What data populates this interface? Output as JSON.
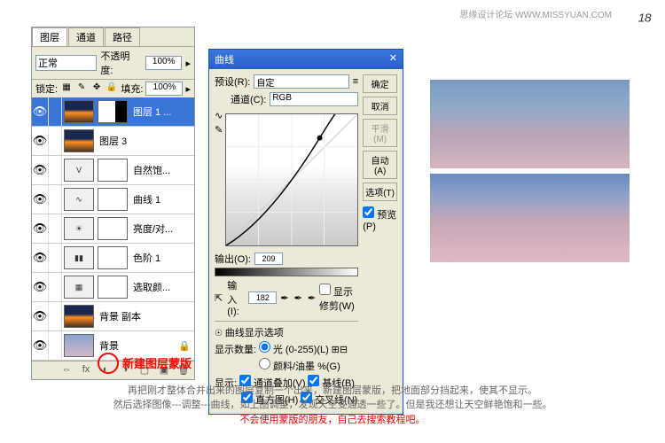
{
  "watermark": "思缘设计论坛  WWW.MISSYUAN.COM",
  "signature": "₁₈",
  "layers_panel": {
    "tabs": [
      "图层",
      "通道",
      "路径"
    ],
    "blend_mode": "正常",
    "opacity_label": "不透明度:",
    "opacity_value": "100%",
    "lock_label": "锁定:",
    "fill_label": "填充:",
    "fill_value": "100%",
    "layers": [
      {
        "name": "图层 1 ...",
        "selected": true,
        "hasMask": true,
        "thumb": "night"
      },
      {
        "name": "图层 3",
        "thumb": "night"
      },
      {
        "name": "自然饱...",
        "adj": "V",
        "hasMask": true
      },
      {
        "name": "曲线 1",
        "adj": "∿",
        "hasMask": true
      },
      {
        "name": "亮度/对...",
        "adj": "☀",
        "hasMask": true
      },
      {
        "name": "色阶 1",
        "adj": "▮▮",
        "hasMask": true
      },
      {
        "name": "选取颜...",
        "adj": "▦",
        "hasMask": true
      },
      {
        "name": "背景 副本",
        "thumb": "night"
      },
      {
        "name": "背景",
        "thumb": "sky",
        "locked": true
      }
    ]
  },
  "mask_annotation": "新建图层蒙版",
  "curves": {
    "title": "曲线",
    "preset_label": "预设(R):",
    "preset_value": "自定",
    "channel_label": "通道(C):",
    "channel_value": "RGB",
    "output_label": "输出(O):",
    "output_value": "209",
    "input_label": "输入(I):",
    "input_value": "182",
    "show_clipping": "显示修剪(W)",
    "display_options": "曲线显示选项",
    "display_amount": "显示数量:",
    "light_option": "光 (0-255)(L)",
    "pigment_option": "颜料/油墨 %(G)",
    "show_label": "显示:",
    "channel_overlay": "通道叠加(V)",
    "baseline": "基线(B)",
    "histogram_chk": "直方图(H)",
    "intersection": "交叉线(N)",
    "buttons": {
      "ok": "确定",
      "cancel": "取消",
      "smooth": "平滑(M)",
      "auto": "自动(A)",
      "options": "选项(T)",
      "preview": "预览(P)"
    }
  },
  "instructions": {
    "line1": "再把刚才整体合并出来的图层复制一个出来，新建图层蒙版，把地面部分挡起来，使其不显示。",
    "line2": "然后选择图像---调整---曲线，如上图调整，发现天空变通透一些了。但是我还想让天空鲜艳饱和一些。",
    "line3": "不会使用蒙版的朋友，自己去搜索教程吧。"
  }
}
